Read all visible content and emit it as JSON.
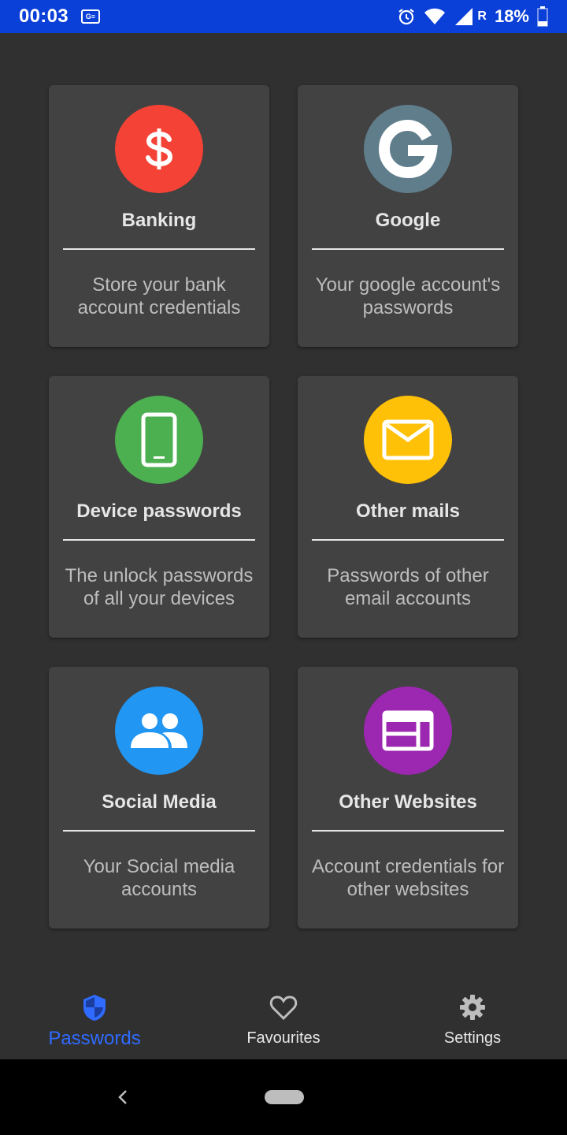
{
  "status": {
    "time": "00:03",
    "battery": "18%",
    "network_tag": "R",
    "notif_label": "G≡"
  },
  "cards": [
    {
      "title": "Banking",
      "desc": "Store your bank account credentials",
      "icon": "dollar-icon",
      "color": "#f44336"
    },
    {
      "title": "Google",
      "desc": "Your google account's passwords",
      "icon": "google-icon",
      "color": "#607d8b"
    },
    {
      "title": "Device passwords",
      "desc": "The unlock passwords of all your devices",
      "icon": "phone-icon",
      "color": "#4caf50"
    },
    {
      "title": "Other mails",
      "desc": "Passwords of other email accounts",
      "icon": "mail-icon",
      "color": "#ffc107"
    },
    {
      "title": "Social Media",
      "desc": "Your Social media accounts",
      "icon": "people-icon",
      "color": "#2196f3"
    },
    {
      "title": "Other Websites",
      "desc": "Account credentials for other websites",
      "icon": "web-icon",
      "color": "#9c27b0"
    }
  ],
  "nav": {
    "passwords": "Passwords",
    "favourites": "Favourites",
    "settings": "Settings"
  },
  "colors": {
    "accent": "#2f6bff",
    "statusbar": "#0a3fd8",
    "background": "#303030",
    "card": "#424242"
  }
}
